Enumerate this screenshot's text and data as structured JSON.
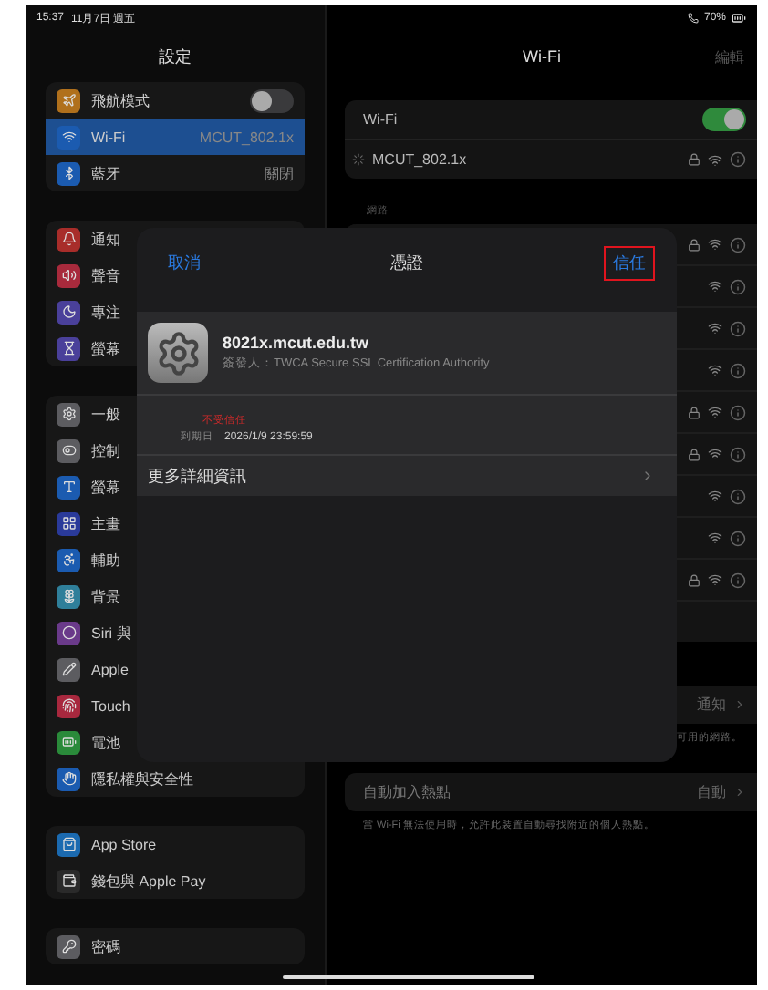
{
  "status_bar": {
    "time": "15:37",
    "date": "11月7日 週五",
    "battery": "70%"
  },
  "sidebar": {
    "title": "設定",
    "groups": [
      {
        "items": [
          {
            "label": "飛航模式",
            "kind": "toggle",
            "on": false,
            "selected": false,
            "color": "#b0701c"
          },
          {
            "label": "Wi-Fi",
            "kind": "value",
            "value": "MCUT_802.1x",
            "selected": true,
            "color": "#1b5bb0"
          },
          {
            "label": "藍牙",
            "kind": "value",
            "value": "關閉",
            "selected": false,
            "color": "#1b5bb0"
          }
        ]
      },
      {
        "items": [
          {
            "label": "通知",
            "kind": "plain",
            "selected": false,
            "color": "#a82d2a"
          },
          {
            "label": "聲音",
            "kind": "plain",
            "selected": false,
            "color": "#a82a3c"
          },
          {
            "label": "專注",
            "kind": "plain",
            "selected": false,
            "color": "#4a409a"
          },
          {
            "label": "螢幕",
            "kind": "plain",
            "selected": false,
            "color": "#4a409a"
          }
        ]
      },
      {
        "items": [
          {
            "label": "一般",
            "kind": "plain",
            "selected": false,
            "color": "#5c5c60"
          },
          {
            "label": "控制",
            "kind": "plain",
            "selected": false,
            "color": "#5c5c60"
          },
          {
            "label": "螢幕",
            "kind": "plain",
            "selected": false,
            "color": "#1b5bb0"
          },
          {
            "label": "主畫",
            "kind": "plain",
            "selected": false,
            "color": "#2a3a9a"
          },
          {
            "label": "輔助",
            "kind": "plain",
            "selected": false,
            "color": "#1b5bb0"
          },
          {
            "label": "背景",
            "kind": "plain",
            "selected": false,
            "color": "#2f7f9a"
          },
          {
            "label": "Siri 與",
            "kind": "plain",
            "selected": false,
            "color": "#6a3a8a"
          },
          {
            "label": "Apple",
            "kind": "plain",
            "selected": false,
            "color": "#5c5c60"
          },
          {
            "label": "Touch",
            "kind": "plain",
            "selected": false,
            "color": "#a8283e"
          },
          {
            "label": "電池",
            "kind": "plain",
            "selected": false,
            "color": "#2a8a3a"
          },
          {
            "label": "隱私權與安全性",
            "kind": "plain",
            "selected": false,
            "color": "#1b5bb0"
          }
        ]
      },
      {
        "items": [
          {
            "label": "App Store",
            "kind": "plain",
            "selected": false,
            "color": "#1b6ab0"
          },
          {
            "label": "錢包與 Apple Pay",
            "kind": "plain",
            "selected": false,
            "color": "#2a2a2a"
          }
        ]
      },
      {
        "items": [
          {
            "label": "密碼",
            "kind": "plain",
            "selected": false,
            "color": "#5c5c60"
          }
        ]
      }
    ]
  },
  "detail": {
    "title": "Wi-Fi",
    "edit": "編輯",
    "wifi_row": {
      "label": "Wi-Fi",
      "on": true
    },
    "current_network": {
      "name": "MCUT_802.1x",
      "connecting": true,
      "secured": true
    },
    "networks_header": "網路",
    "networks": [
      {
        "secured": true
      },
      {
        "secured": false
      },
      {
        "secured": false
      },
      {
        "secured": false
      },
      {
        "secured": true
      },
      {
        "secured": true
      },
      {
        "secured": false
      },
      {
        "secured": false
      },
      {
        "secured": true
      }
    ],
    "ask_to_join": {
      "value": "通知",
      "caption": "可用的網路。"
    },
    "hotspot": {
      "label": "自動加入熱點",
      "value": "自動",
      "caption": "當 Wi-Fi 無法使用時，允許此裝置自動尋找附近的個人熱點。"
    }
  },
  "dialog": {
    "cancel": "取消",
    "title": "憑證",
    "trust": {
      "label": "信任",
      "highlighted": true
    },
    "certificate": {
      "name": "8021x.mcut.edu.tw",
      "issuer": "簽發人：TWCA Secure SSL Certification Authority",
      "status": "不受信任",
      "expiry_label": "到期日",
      "expiry": "2026/1/9 23:59:59"
    },
    "more": "更多詳細資訊"
  }
}
